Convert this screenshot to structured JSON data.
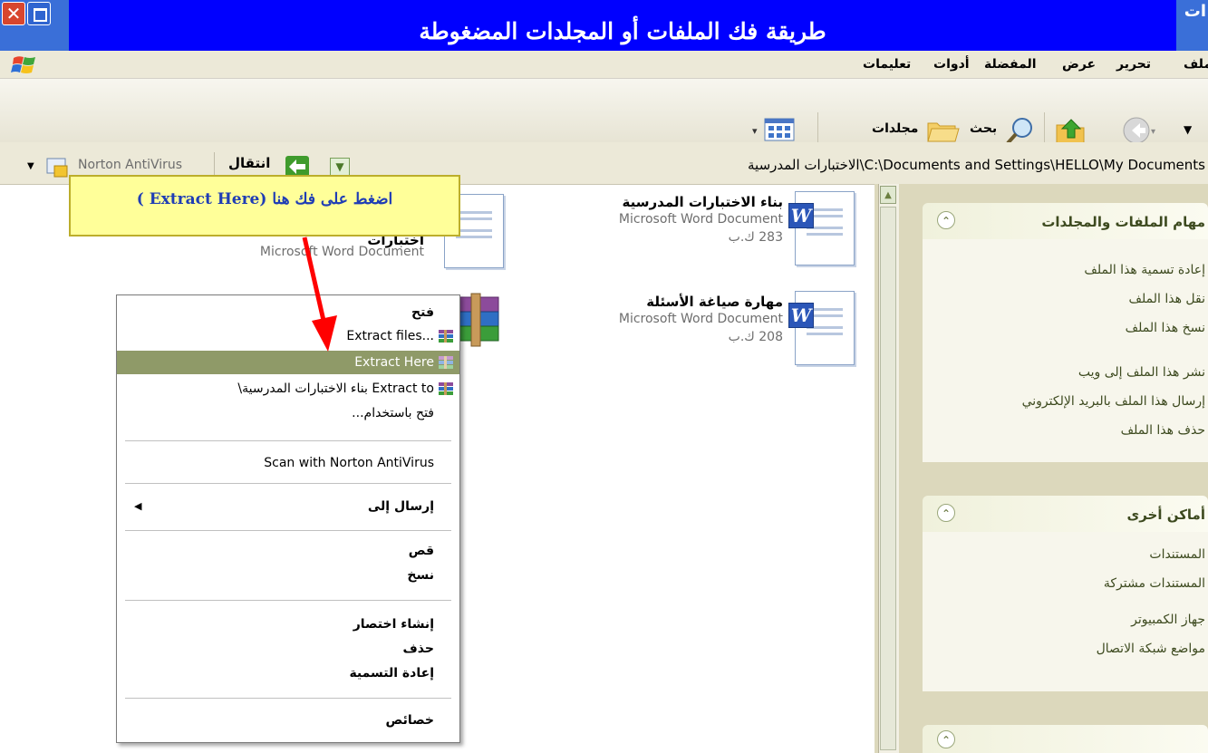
{
  "banner": {
    "title": "طريقة فك الملفات أو المجلدات المضغوطة"
  },
  "window": {
    "close_glyph": "✕",
    "title_edge": "ات"
  },
  "menubar": {
    "items": [
      "ملف",
      "تحرير",
      "عرض",
      "المفضلة",
      "أدوات",
      "تعليمات"
    ]
  },
  "toolbar": {
    "search_label": "بحث",
    "folders_label": "مجلدات"
  },
  "addressbar": {
    "path": "C:\\Documents and Settings\\HELLO\\My Documents\\الاختبارات المدرسية",
    "go_label": "انتقال",
    "norton_label": "Norton AntiVirus"
  },
  "files": [
    {
      "name": "بناء الاختبارات المدرسية",
      "type": "Microsoft Word Document",
      "size": "283 ك.ب"
    },
    {
      "name": "مهارة صياغة الأسئلة",
      "type": "Microsoft Word Document",
      "size": "208 ك.ب"
    },
    {
      "name": "اختبارات",
      "type": "Microsoft Word Document",
      "size": ""
    }
  ],
  "callout": {
    "text": "اضغط على فك هنا (Extract Here )"
  },
  "context_menu": {
    "open": "فتح",
    "extract_files": "...Extract files",
    "extract_here": "Extract Here",
    "extract_to": "Extract to بناء الاختبارات المدرسية\\",
    "open_with": "فتح باستخدام...",
    "scan": "Scan with Norton AntiVirus",
    "send_to": "إرسال إلى",
    "cut": "قص",
    "copy": "نسخ",
    "create_shortcut": "إنشاء اختصار",
    "delete": "حذف",
    "rename": "إعادة التسمية",
    "properties": "خصائص"
  },
  "taskpane": {
    "file_tasks": {
      "title": "مهام الملفات والمجلدات",
      "links": [
        "إعادة تسمية هذا الملف",
        "نقل هذا الملف",
        "نسخ هذا الملف",
        "نشر هذا الملف إلى ويب",
        "إرسال هذا الملف بالبريد الإلكتروني",
        "حذف هذا الملف"
      ]
    },
    "other_places": {
      "title": "أماكن أخرى",
      "links": [
        "المستندات",
        "المستندات مشتركة",
        "جهاز الكمبيوتر",
        "مواضع شبكة الاتصال"
      ]
    }
  },
  "colors": {
    "banner": "#0000ff",
    "callout_bg": "#ffff99",
    "selection": "#8f9a68",
    "arrow": "#ff0000"
  }
}
